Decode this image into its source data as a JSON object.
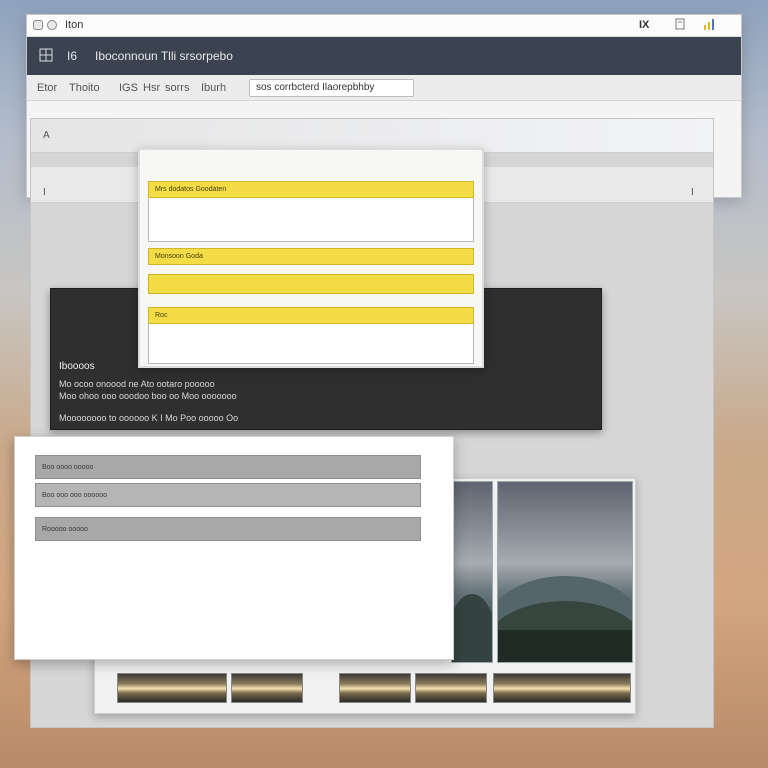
{
  "window": {
    "tab_title": "Iton",
    "titlebar_right": "IX",
    "toolbar": {
      "icon_label": "I6",
      "title": "Iboconnoun Tlli srsorpebo"
    },
    "menu": {
      "items": [
        "Etor",
        "Thoito",
        "IGS",
        "Hsr",
        "sorrs",
        "Iburh"
      ],
      "address_value": "sos corrbcterd Ilaorepbhby"
    }
  },
  "canvas": {
    "strip_a_char": "A",
    "strip_b_char": "I"
  },
  "yellow_form": {
    "row1_label": "Mrs dodatos Goodaten",
    "row2_label": "Monsoon Goda",
    "row3_label": "Roc"
  },
  "dark_panel": {
    "heading": "Iboooos",
    "line1": "Mo ocoo onoood ne Ato ootaro pooooo",
    "line2": "Moo ohoo ooo ooodoo boo oo Moo ooooooo",
    "line3": "Moooooooo to oooooo K I Mo Poo ooooo Oo"
  },
  "grey_form": {
    "row1_label": "Boo oooo ooooo",
    "row2_label": "Boo ooo ooo oooooo",
    "row3_label": "Rooooo ooooo"
  },
  "colors": {
    "toolbar_bg": "#3c4350",
    "dialog_yellow": "#f3dc45",
    "dark_panel_bg": "#2f2f30",
    "form_grey": "#a8a8a8"
  }
}
